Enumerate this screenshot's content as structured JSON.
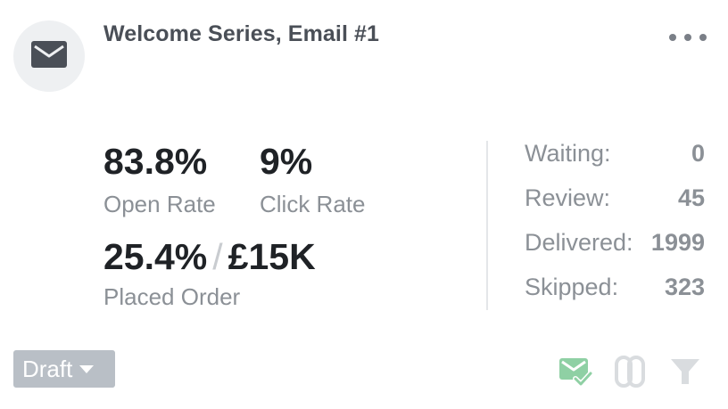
{
  "card": {
    "title": "Welcome Series, Email #1",
    "icon": "envelope-icon",
    "menu_icon": "more-horizontal-icon"
  },
  "metrics": {
    "open_rate": {
      "value": "83.8%",
      "label": "Open Rate"
    },
    "click_rate": {
      "value": "9%",
      "label": "Click Rate"
    },
    "placed_order": {
      "percent": "25.4%",
      "separator": "/",
      "revenue": "£15K",
      "label": "Placed Order"
    }
  },
  "stats": [
    {
      "label": "Waiting:",
      "value": "0"
    },
    {
      "label": "Review:",
      "value": "45"
    },
    {
      "label": "Delivered:",
      "value": "1999"
    },
    {
      "label": "Skipped:",
      "value": "323"
    }
  ],
  "footer": {
    "status_label": "Draft",
    "icons": [
      "email-check-icon",
      "paperclip-icon",
      "filter-icon"
    ]
  },
  "colors": {
    "accent_green": "#8fd0a4",
    "muted_gray": "#8b9096",
    "draft_bg": "#b9bfc6"
  }
}
